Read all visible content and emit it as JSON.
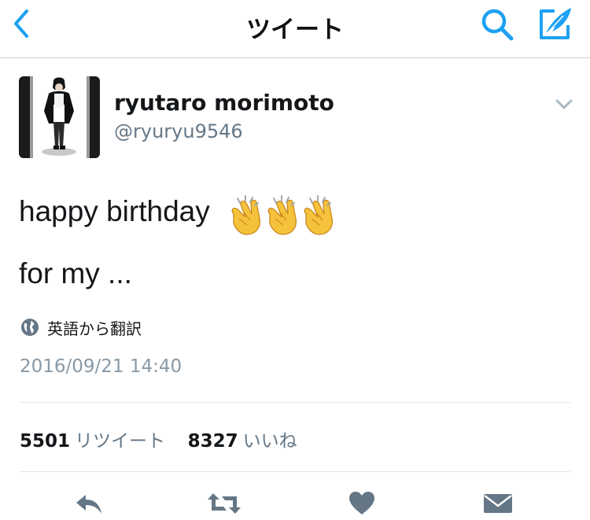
{
  "nav": {
    "title": "ツイート",
    "back_icon": "chevron-left-icon",
    "search_icon": "search-icon",
    "compose_icon": "compose-tweet-icon",
    "accent_color": "#1da1f2"
  },
  "tweet": {
    "author_name": "ryutaro morimoto",
    "author_handle": "@ryuryu9546",
    "text_line1": "happy birthday",
    "text_line1_emoji": [
      "clapping-hands",
      "clapping-hands",
      "clapping-hands"
    ],
    "text_line2": "for my ...",
    "translate_label": "英語から翻訳",
    "timestamp": "2016/09/21 14:40"
  },
  "stats": {
    "retweet_count": "5501",
    "retweet_label": "リツイート",
    "like_count": "8327",
    "like_label": "いいね"
  },
  "actions": [
    "reply-icon",
    "retweet-icon",
    "like-heart-icon",
    "direct-message-icon"
  ]
}
